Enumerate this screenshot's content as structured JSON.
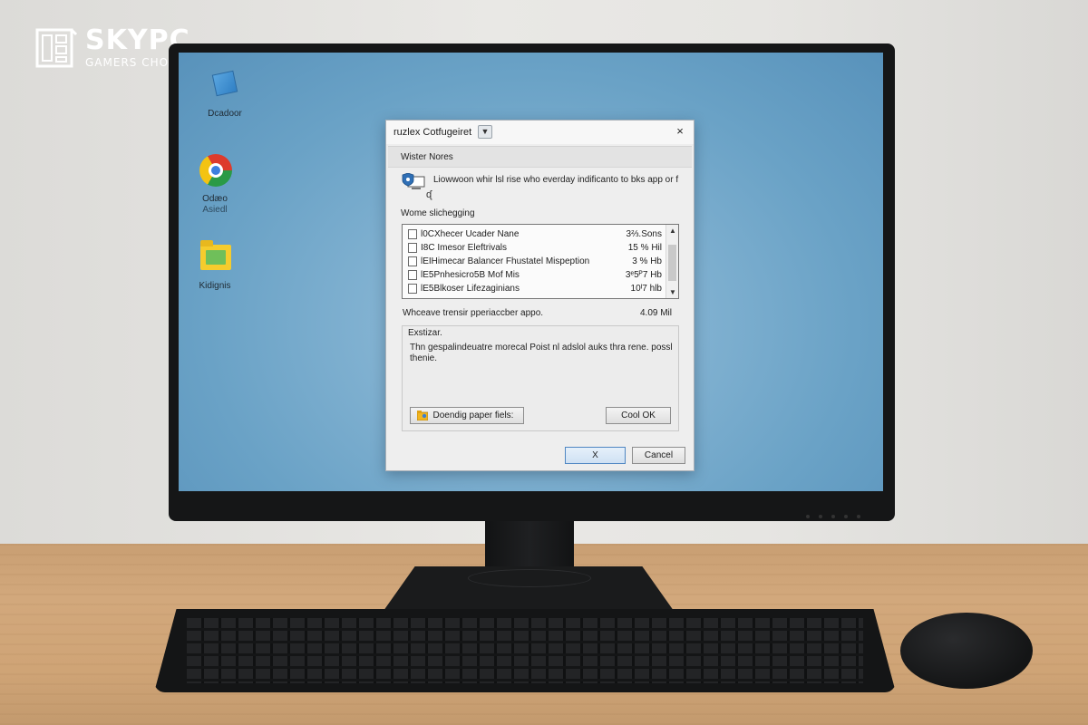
{
  "logo": {
    "name": "SKYPC",
    "tagline": "GAMERS CHOICE"
  },
  "desktop_icons": [
    {
      "label": "Dcadoor",
      "sublabel": "",
      "icon": "blue-square-icon"
    },
    {
      "label": "Odæo",
      "sublabel": "Asiedl",
      "icon": "chrome-icon"
    },
    {
      "label": "Kidignis",
      "sublabel": "",
      "icon": "folder-icon"
    }
  ],
  "dialog": {
    "title": "ruzlex Cotfugeiret",
    "close_glyph": "×",
    "section_header": "Wister Nores",
    "info_text": "Liowwoon whir lsl rise who everday indificanto to bks app or f",
    "info_sub": "ᶑ",
    "list_label": "Wome slichegging",
    "list_items": [
      {
        "name": "l0CXhecer Ucader Nane",
        "size": "3⅔.Sons"
      },
      {
        "name": "I8C Imesor Eleftrivals",
        "size": "15 % Hil"
      },
      {
        "name": "lEIHimecar Balancer Fhustatel Mispeption",
        "size": "3 % Hb"
      },
      {
        "name": "lE5Pnhesicro5B Mof Mis",
        "size": "3ᵉ5ᴾ7 Hb"
      },
      {
        "name": "lE5Blkoser Lifezaginians",
        "size": "10ᴵ7 hlb"
      }
    ],
    "space_label": "Whceave trensir pperiaccber appo.",
    "space_value": "4.09 Mil",
    "description_title": "Exstizar.",
    "description_text": "Thn gespalindeuatre morecal Poist nl adslol auks thra rene. possl thenie.",
    "view_button": "Doendig paper fiels:",
    "ok_button": "Cool OK",
    "primary_button": "X",
    "cancel_button": "Cancel"
  },
  "colors": {
    "screen": "#7fb0d0",
    "dialog_bg": "#eeeeee",
    "primary_border": "#4f86c2"
  }
}
